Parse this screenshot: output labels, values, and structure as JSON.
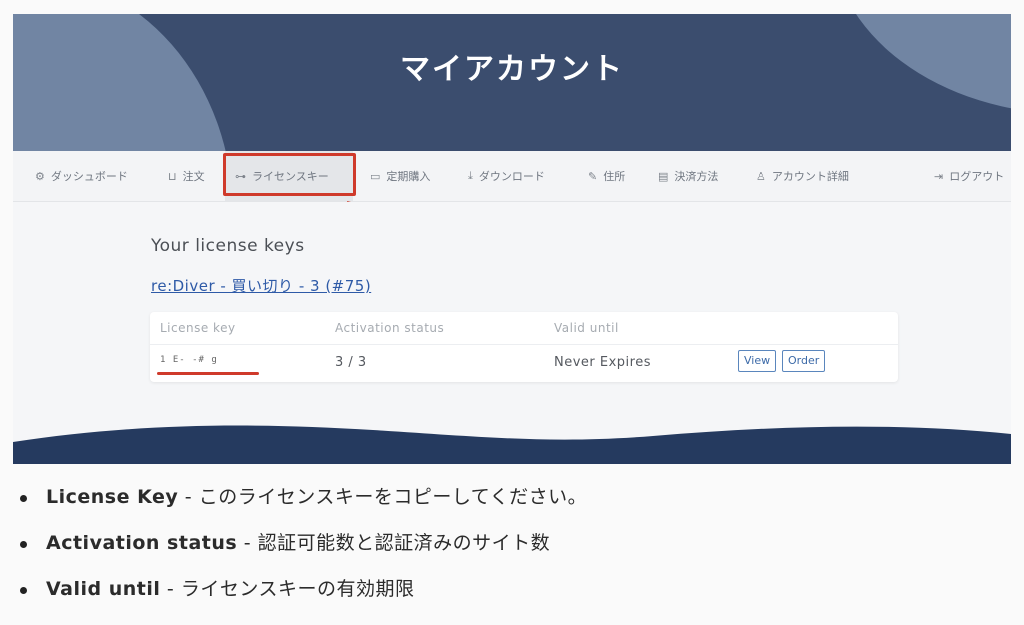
{
  "hero": {
    "title": "マイアカウント"
  },
  "nav": {
    "items": [
      {
        "icon": "gear-icon",
        "glyph": "⚙",
        "label": "ダッシュボード"
      },
      {
        "icon": "basket-icon",
        "glyph": "🛒",
        "label": "注文"
      },
      {
        "icon": "key-icon",
        "glyph": "⚿",
        "label": "ライセンスキー"
      },
      {
        "icon": "calendar-icon",
        "glyph": "▭",
        "label": "定期購入"
      },
      {
        "icon": "download-icon",
        "glyph": "⤓",
        "label": "ダウンロード"
      },
      {
        "icon": "edit-icon",
        "glyph": "✎",
        "label": "住所"
      },
      {
        "icon": "card-icon",
        "glyph": "▤",
        "label": "決済方法"
      },
      {
        "icon": "user-icon",
        "glyph": "👤",
        "label": "アカウント詳細"
      },
      {
        "icon": "logout-icon",
        "glyph": "⇥",
        "label": "ログアウト"
      }
    ],
    "active_index": 2
  },
  "content": {
    "title": "Your license keys",
    "product_link": "re:Diver - 買い切り - 3 (#75)",
    "table": {
      "headers": [
        "License key",
        "Activation status",
        "Valid until"
      ],
      "row": {
        "key_masked": "1   E-       -#  g",
        "activation": "3 / 3",
        "valid_until": "Never Expires",
        "view_label": "View",
        "order_label": "Order"
      }
    }
  },
  "bullets": [
    {
      "term": "License Key",
      "desc": " - このライセンスキーをコピーしてください。"
    },
    {
      "term": "Activation status",
      "desc": " - 認証可能数と認証済みのサイト数"
    },
    {
      "term": "Valid until",
      "desc": " - ライセンスキーの有効期限"
    }
  ],
  "colors": {
    "hero_bg": "#3b4d6e",
    "hero_shape": "#7185a3",
    "highlight": "#cf3a2b",
    "link": "#2e5aa7"
  }
}
